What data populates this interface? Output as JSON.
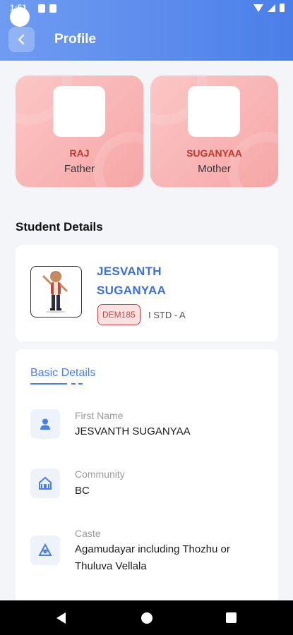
{
  "status_bar": {
    "time": "1:51"
  },
  "header": {
    "title": "Profile"
  },
  "parents": [
    {
      "name": "RAJ",
      "relation": "Father"
    },
    {
      "name": "SUGANYAA",
      "relation": "Mother"
    }
  ],
  "student_section": {
    "title": "Student Details"
  },
  "student": {
    "name_line1": "JESVANTH",
    "name_line2": "SUGANYAA",
    "id": "DEM185",
    "class": "I STD - A"
  },
  "details": {
    "tab_label": "Basic Details",
    "fields": [
      {
        "label": "First Name",
        "value": "JESVANTH SUGANYAA",
        "icon": "person-icon"
      },
      {
        "label": "Community",
        "value": "BC",
        "icon": "community-icon"
      },
      {
        "label": "Caste",
        "value": "Agamudayar including Thozhu or Thuluva Vellala",
        "icon": "caste-icon"
      }
    ]
  },
  "colors": {
    "accent": "#4b7fe8",
    "parent_card": "#f6a6a6",
    "badge": "#c04848"
  },
  "icons": {
    "back": "chevron-left-icon"
  }
}
